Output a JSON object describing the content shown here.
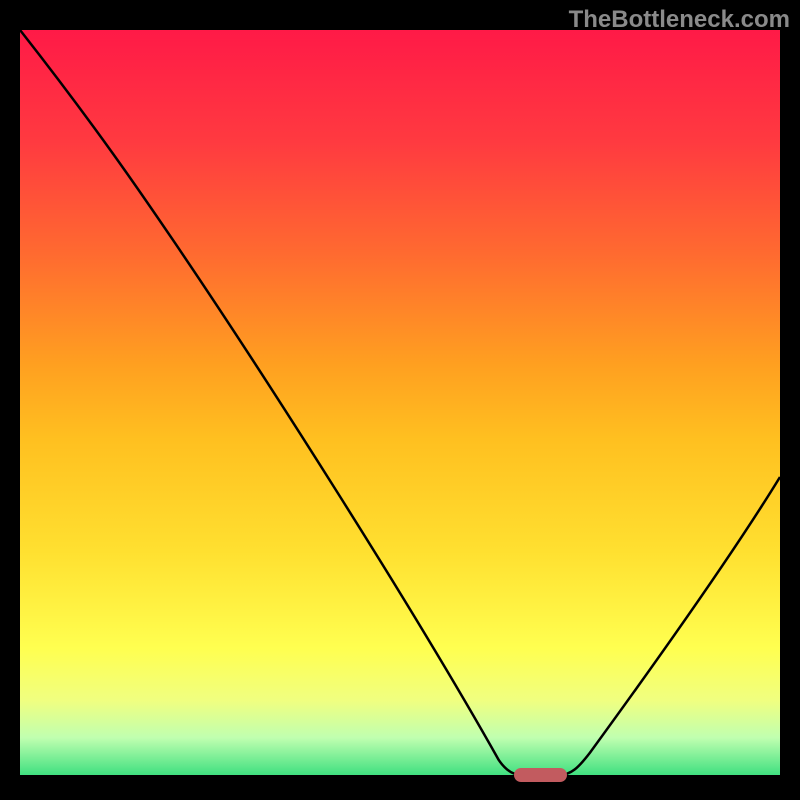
{
  "watermark": "TheBottleneck.com",
  "chart_data": {
    "type": "line",
    "title": "",
    "xlabel": "",
    "ylabel": "",
    "x_range": [
      0,
      100
    ],
    "y_range": [
      0,
      100
    ],
    "series": [
      {
        "name": "curve",
        "points": [
          {
            "x": 0,
            "y": 100
          },
          {
            "x": 20,
            "y": 72
          },
          {
            "x": 63,
            "y": 2
          },
          {
            "x": 65,
            "y": 0
          },
          {
            "x": 72,
            "y": 0
          },
          {
            "x": 74,
            "y": 2
          },
          {
            "x": 100,
            "y": 40
          }
        ]
      }
    ],
    "marker": {
      "x_start": 65,
      "x_end": 72,
      "y": 0
    },
    "gradient_stops": [
      {
        "pos": 0,
        "color": "#ff1a47"
      },
      {
        "pos": 50,
        "color": "#ffc020"
      },
      {
        "pos": 85,
        "color": "#ffff50"
      },
      {
        "pos": 100,
        "color": "#40e080"
      }
    ]
  }
}
